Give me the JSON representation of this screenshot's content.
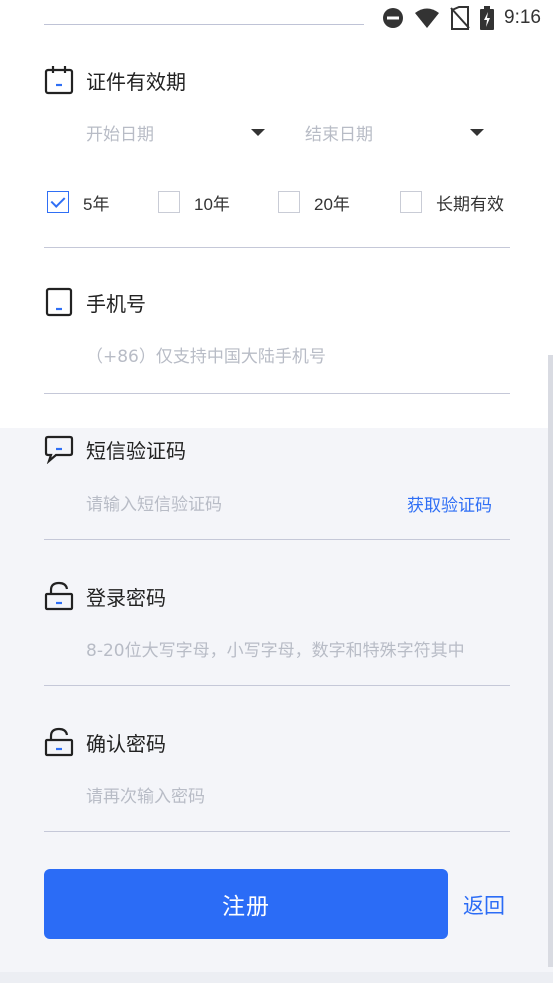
{
  "status_bar": {
    "time": "9:16",
    "icons": [
      "do-not-disturb-icon",
      "wifi-icon",
      "no-sim-icon",
      "battery-charging-icon"
    ]
  },
  "validity": {
    "title": "证件有效期",
    "start_placeholder": "开始日期",
    "end_placeholder": "结束日期",
    "options": [
      {
        "label": "5年",
        "checked": true
      },
      {
        "label": "10年",
        "checked": false
      },
      {
        "label": "20年",
        "checked": false
      },
      {
        "label": "长期有效",
        "checked": false
      }
    ]
  },
  "phone": {
    "title": "手机号",
    "placeholder": "（+86）仅支持中国大陆手机号"
  },
  "sms": {
    "title": "短信验证码",
    "placeholder": "请输入短信验证码",
    "get_code_label": "获取验证码"
  },
  "password": {
    "title": "登录密码",
    "placeholder": "8-20位大写字母，小写字母，数字和特殊字符其中"
  },
  "confirm": {
    "title": "确认密码",
    "placeholder": "请再次输入密码"
  },
  "actions": {
    "register_label": "注册",
    "back_label": "返回"
  },
  "colors": {
    "accent": "#2b6cf6",
    "placeholder": "#b8bcc6",
    "divider": "#c5c8d8"
  }
}
